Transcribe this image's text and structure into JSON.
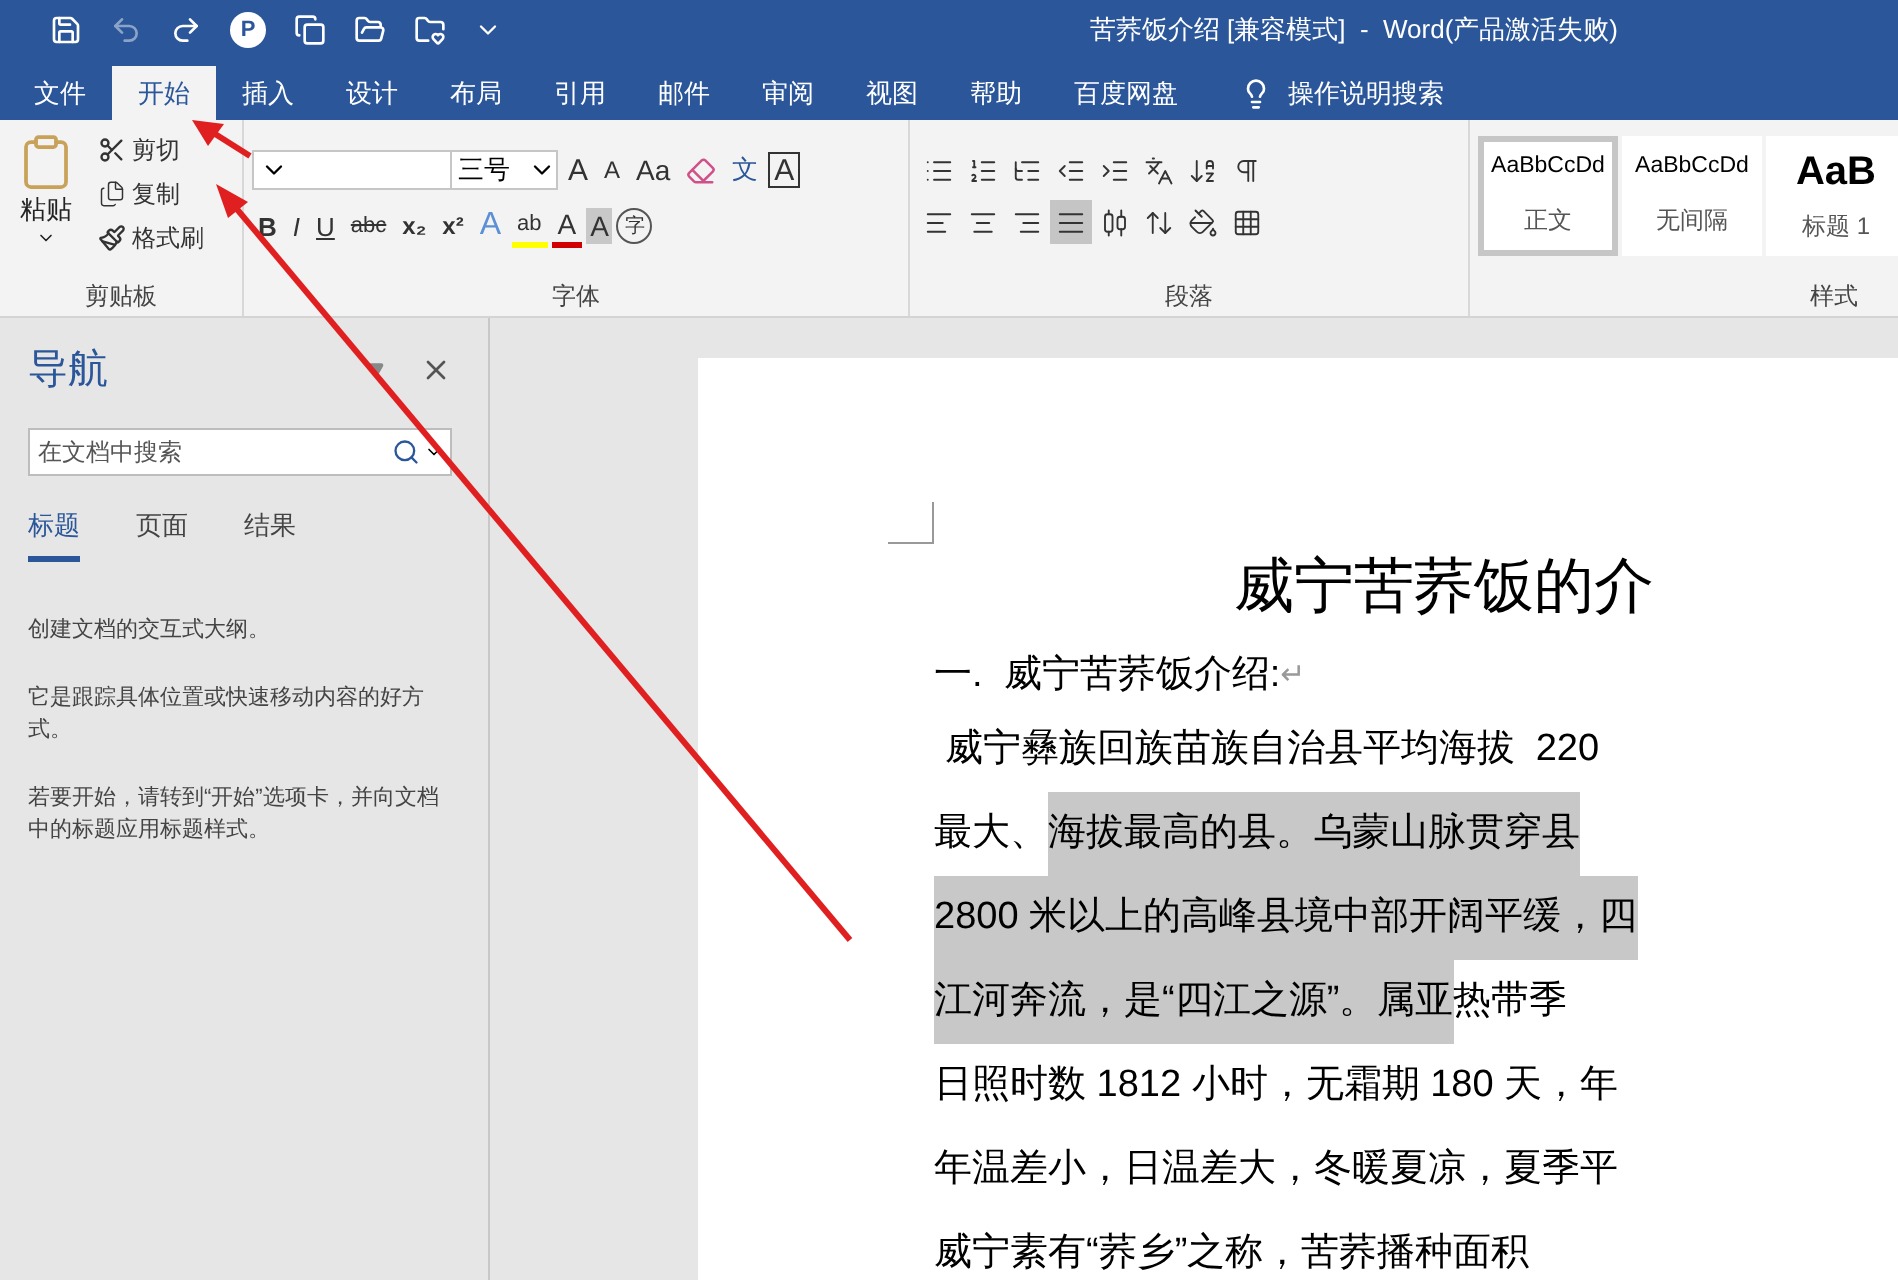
{
  "window": {
    "title": "苦荞饭介绍 [兼容模式]  -  Word(产品激活失败)"
  },
  "quick_access": [
    {
      "kind": "save",
      "disabled": false
    },
    {
      "kind": "undo",
      "disabled": true
    },
    {
      "kind": "redo",
      "disabled": false
    },
    {
      "kind": "badge",
      "label": "P",
      "disabled": false
    },
    {
      "kind": "doc",
      "disabled": false
    },
    {
      "kind": "folder",
      "disabled": false
    },
    {
      "kind": "star",
      "disabled": false
    },
    {
      "kind": "more",
      "disabled": false
    }
  ],
  "menu_tabs": [
    {
      "label": "文件",
      "selected": false
    },
    {
      "label": "开始",
      "selected": true
    },
    {
      "label": "插入",
      "selected": false
    },
    {
      "label": "设计",
      "selected": false
    },
    {
      "label": "布局",
      "selected": false
    },
    {
      "label": "引用",
      "selected": false
    },
    {
      "label": "邮件",
      "selected": false
    },
    {
      "label": "审阅",
      "selected": false
    },
    {
      "label": "视图",
      "selected": false
    },
    {
      "label": "帮助",
      "selected": false
    },
    {
      "label": "百度网盘",
      "selected": false
    }
  ],
  "tell_me": "操作说明搜索",
  "clipboard": {
    "paste": "粘贴",
    "actions": [
      {
        "kind": "cut",
        "label": "剪切"
      },
      {
        "kind": "copy",
        "label": "复制"
      },
      {
        "kind": "painter",
        "label": "格式刷"
      }
    ],
    "group_label": "剪贴板"
  },
  "font": {
    "font_size": "三号",
    "row1": [
      {
        "kind": "grow",
        "label": "A"
      },
      {
        "kind": "shrink",
        "label": "A"
      },
      {
        "kind": "case",
        "label": "Aa"
      },
      {
        "kind": "clear"
      },
      {
        "kind": "pinyin",
        "label": "文"
      },
      {
        "kind": "border",
        "label": "A"
      }
    ],
    "row2": [
      {
        "kind": "bold",
        "label": "B"
      },
      {
        "kind": "italic",
        "label": "I"
      },
      {
        "kind": "underline",
        "label": "U"
      },
      {
        "kind": "strike",
        "label": "abc"
      },
      {
        "kind": "sub",
        "label": "x₂"
      },
      {
        "kind": "sup",
        "label": "x²"
      },
      {
        "kind": "effect",
        "label": "A"
      },
      {
        "kind": "highlight",
        "label": "ab"
      },
      {
        "kind": "color",
        "label": "A"
      },
      {
        "kind": "shade",
        "label": "A"
      },
      {
        "kind": "circle",
        "label": "字"
      }
    ],
    "group_label": "字体"
  },
  "paragraph": {
    "group_label": "段落",
    "justify_selected": true
  },
  "styles": {
    "items": [
      {
        "preview": "AaBbCcDd",
        "name": "正文",
        "selected": true,
        "kind": "normal"
      },
      {
        "preview": "AaBbCcDd",
        "name": "无间隔",
        "selected": false,
        "kind": "normal"
      },
      {
        "preview": "AaB",
        "name": "标题 1",
        "selected": false,
        "kind": "heading"
      }
    ],
    "group_label": "样式"
  },
  "nav": {
    "title": "导航",
    "search": {
      "placeholder": "在文档中搜索"
    },
    "tabs": [
      {
        "label": "标题",
        "selected": true
      },
      {
        "label": "页面",
        "selected": false
      },
      {
        "label": "结果",
        "selected": false
      }
    ],
    "texts": [
      "创建文档的交互式大纲。",
      "它是跟踪具体位置或快速移动内容的好方式。",
      "若要开始，请转到“开始”选项卡，并向文档中的标题应用标题样式。"
    ]
  },
  "document": {
    "title": "威宁苦荞饭的介",
    "heading": "一.  威宁苦荞饭介绍:",
    "heading_mark": "↵",
    "lines": [
      [
        {
          "text": " 威宁彝族回族苗族自治县平均海拔  220",
          "selected": false
        }
      ],
      [
        {
          "text": "最大、",
          "selected": false
        },
        {
          "text": "海拔最高的县。乌蒙山脉贯穿县",
          "selected": true
        }
      ],
      [
        {
          "text": "2800 米以上的高峰县境中部开阔平缓，四",
          "selected": true
        }
      ],
      [
        {
          "text": "江河奔流，是“四江之源”。属亚",
          "selected": true
        },
        {
          "text": "热带季",
          "selected": false
        }
      ],
      [
        {
          "text": "日照时数 1812 小时，无霜期 180 天，年",
          "selected": false
        }
      ],
      [
        {
          "text": "年温差小，日温差大，冬暖夏凉，夏季平",
          "selected": false
        }
      ],
      [
        {
          "text": "威宁素有“荞乡”之称，苦荞播种面积",
          "selected": false
        }
      ]
    ]
  }
}
